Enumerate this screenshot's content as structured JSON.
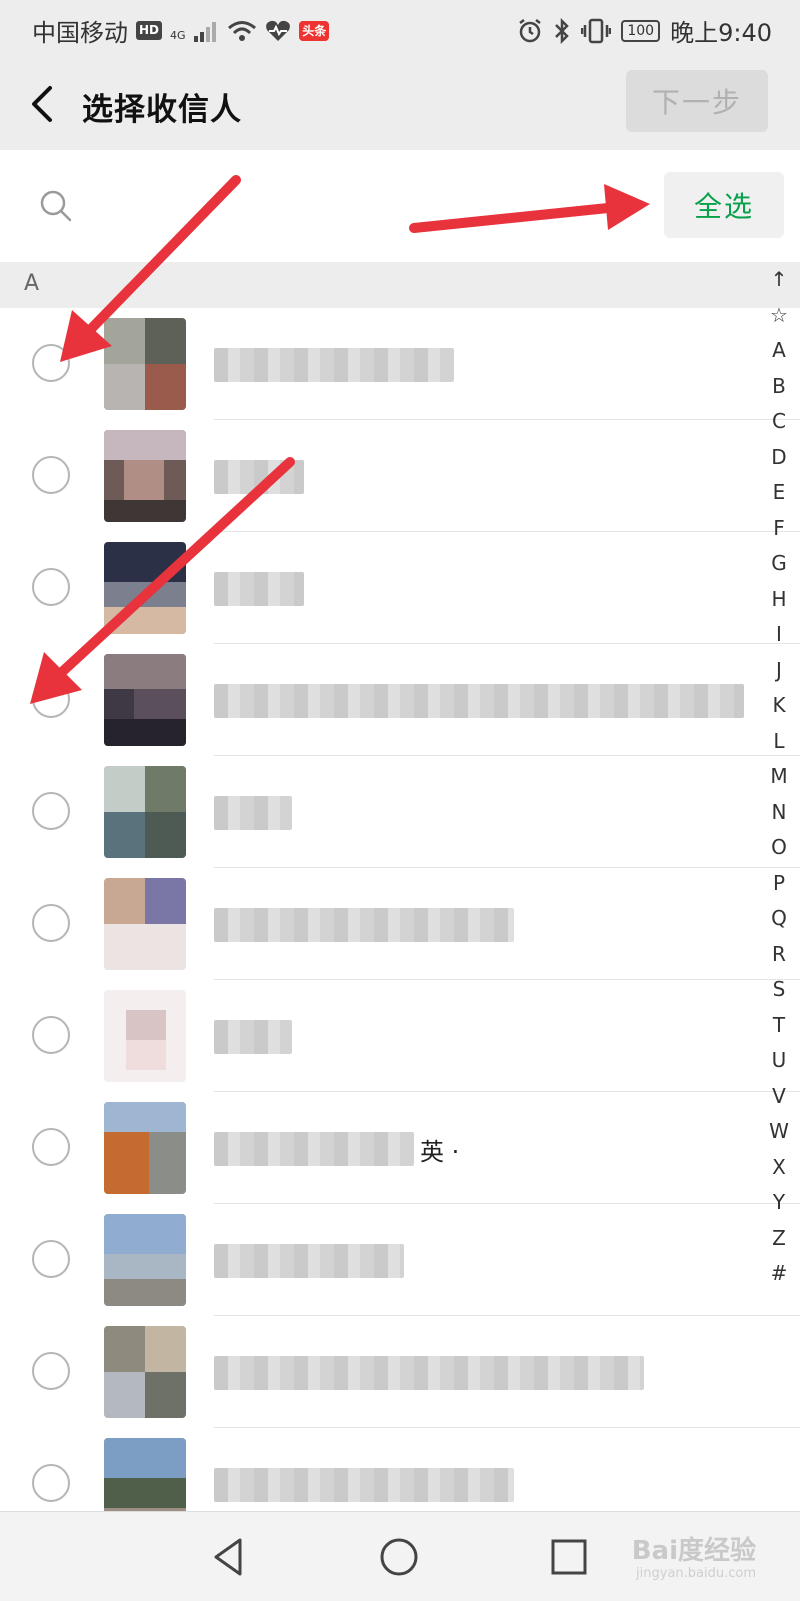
{
  "status_bar": {
    "carrier": "中国移动",
    "hd": "HD",
    "network": "4G",
    "news_badge": "头条",
    "battery": "100",
    "time": "晚上9:40"
  },
  "header": {
    "title": "选择收信人",
    "next_label": "下一步"
  },
  "search": {
    "placeholder": "",
    "select_all_label": "全选"
  },
  "section": {
    "label": "A"
  },
  "contacts": [
    {
      "visible_name": ""
    },
    {
      "visible_name": ""
    },
    {
      "visible_name": ""
    },
    {
      "visible_name": ""
    },
    {
      "visible_name": ""
    },
    {
      "visible_name": ""
    },
    {
      "visible_name": ""
    },
    {
      "visible_name": "英 ·"
    },
    {
      "visible_name": ""
    },
    {
      "visible_name": ""
    },
    {
      "visible_name": ""
    }
  ],
  "alphabet_index": [
    "↑",
    "☆",
    "A",
    "B",
    "C",
    "D",
    "E",
    "F",
    "G",
    "H",
    "I",
    "J",
    "K",
    "L",
    "M",
    "N",
    "O",
    "P",
    "Q",
    "R",
    "S",
    "T",
    "U",
    "V",
    "W",
    "X",
    "Y",
    "Z",
    "#"
  ],
  "watermark": {
    "text": "Bai度经验",
    "sub": "jingyan.baidu.com"
  },
  "colors": {
    "accent_green": "#07a04b",
    "arrow_red": "#e8323c",
    "header_bg": "#ededed"
  },
  "icons": [
    "back-arrow-icon",
    "search-icon",
    "wifi-icon",
    "heart-icon",
    "alarm-icon",
    "bluetooth-icon",
    "vibrate-icon",
    "nav-back-icon",
    "nav-home-icon",
    "nav-recent-icon"
  ]
}
